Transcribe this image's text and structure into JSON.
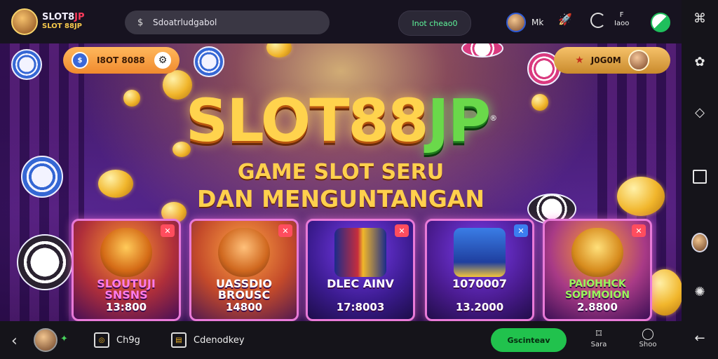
{
  "topbar": {
    "logo_line1": "SLOT8",
    "logo_line1_accent": "JP",
    "logo_line2": "SLOT 88JP",
    "search_value": "Sdoatrludgabol",
    "login_label": "Inot cheao0",
    "user_label": "Mk",
    "item_3_label": "Iaoo",
    "item_3_prefix": "F"
  },
  "hero": {
    "balance_value": "I8OT 8088",
    "jackpot_value": "J0G0M",
    "title_main": "SLOT88",
    "title_accent": "JP",
    "title_mark": "®",
    "subtitle_1": "GAME SLOT SERU",
    "subtitle_2": "DAN MENGUNTANGAN"
  },
  "games": [
    {
      "name": "SLOUTUJI SNSNS",
      "amount": "13:800",
      "badge": "✕",
      "badge_color": "#ff4d5e"
    },
    {
      "name": "UASSDIO BROUSC",
      "amount": "14800",
      "badge": "✕",
      "badge_color": "#ff4d5e"
    },
    {
      "name": "DLEC AINV",
      "amount": "17:8003",
      "badge": "✕",
      "badge_color": "#ff4d5e"
    },
    {
      "name": "1070007",
      "amount": "13.2000",
      "badge": "✕",
      "badge_color": "#3c7df0"
    },
    {
      "name": "PAIOHHCK SOPIMOION",
      "amount": "2.8800",
      "badge": "✕",
      "badge_color": "#ff4d5e"
    }
  ],
  "bottombar": {
    "item1_label": "Ch9g",
    "item2_label": "Cdenodkey",
    "green_btn_label": "Gscinteav",
    "col1_label": "Sara",
    "col2_label": "Shoo"
  },
  "colors": {
    "accent_green": "#21c24d",
    "title_gold": "#ffd34d",
    "title_green": "#6ad94a",
    "card_border": "#e97ad8"
  },
  "icons": [
    "dollar-icon",
    "rocket-icon",
    "swirl-icon",
    "coin-icon",
    "gear-icon",
    "star-icon",
    "close-icon",
    "back-icon",
    "leaf-icon",
    "chat-icon",
    "bookmark-icon",
    "square-icon",
    "home-icon",
    "avatar"
  ]
}
